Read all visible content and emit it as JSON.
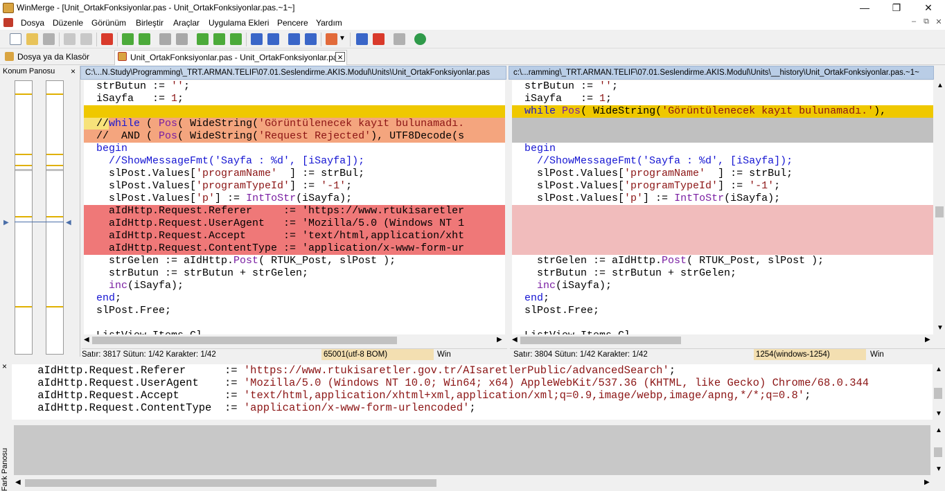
{
  "window": {
    "title": "WinMerge - [Unit_OrtakFonksiyonlar.pas - Unit_OrtakFonksiyonlar.pas.~1~]",
    "controls": [
      "—",
      "❐",
      "✕"
    ]
  },
  "menu": {
    "items": [
      "Dosya",
      "Düzenle",
      "Görünüm",
      "Birleştir",
      "Araçlar",
      "Uygulama Ekleri",
      "Pencere",
      "Yardım"
    ],
    "mdi_controls": [
      "–",
      "⧉",
      "✕"
    ]
  },
  "tabs": [
    {
      "label": "Dosya ya da Klasör Seçin"
    },
    {
      "label": "Unit_OrtakFonksiyonlar.pas - Unit_OrtakFonksiyonlar.pas"
    }
  ],
  "tab_close": "×",
  "location_pane": {
    "title": "Konum Panosu",
    "close": "×"
  },
  "left": {
    "path": "C:\\...N.Study\\Programming\\_TRT.ARMAN.TELIF\\07.01.Seslendirme.AKIS.Modul\\Units\\Unit_OrtakFonksiyonlar.pas",
    "status": "Satır: 3817  Sütun: 1/42  Karakter: 1/42",
    "encoding": "65001(utf-8 BOM)",
    "eol": "Win"
  },
  "right": {
    "path": "c:\\...ramming\\_TRT.ARMAN.TELIF\\07.01.Seslendirme.AKIS.Modul\\Units\\__history\\Unit_OrtakFonksiyonlar.pas.~1~",
    "status": "Satır: 3804  Sütun: 1/42  Karakter: 1/42",
    "encoding": "1254(windows-1254)",
    "eol": "Win"
  },
  "diff_pane": {
    "close": "×",
    "label": "Fark Panosu",
    "lines": [
      [
        "    aIdHttp.Request.Referer      := ",
        "'https://www.rtukisaretler.gov.tr/AIsaretlerPublic/advancedSearch'",
        ";"
      ],
      [
        "    aIdHttp.Request.UserAgent    := ",
        "'Mozilla/5.0 (Windows NT 10.0; Win64; x64) AppleWebKit/537.36 (KHTML, like Gecko) Chrome/68.0.344",
        ""
      ],
      [
        "    aIdHttp.Request.Accept       := ",
        "'text/html,application/xhtml+xml,application/xml;q=0.9,image/webp,image/apng,*/*;q=0.8'",
        ";"
      ],
      [
        "    aIdHttp.Request.ContentType  := ",
        "'application/x-www-form-urlencoded'",
        ";"
      ]
    ]
  },
  "colors": {
    "moved_yellow": "#efc800",
    "changed_orange": "#f4a57e",
    "missing_gray": "#c0c0c0",
    "deleted_red": "#ef7878",
    "deleted_pink": "#f1bcbc"
  }
}
